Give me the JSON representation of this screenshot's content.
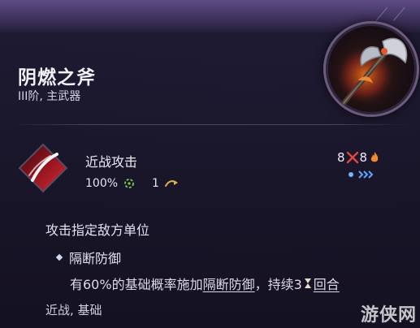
{
  "item": {
    "name": "阴燃之斧",
    "subtitle": "III阶, 主武器"
  },
  "skill": {
    "name": "近战攻击",
    "accuracy": "100%",
    "range": "1",
    "cost_action": "8",
    "cost_fire": "8",
    "description": "攻击指定敌方单位",
    "effect_name": "隔断防御",
    "effect_text": {
      "pre": "有60%的基础概率施加",
      "status_link": "隔断防御",
      "mid": "，持续3",
      "turn_link": "回合"
    },
    "tags": "近战, 基础"
  },
  "watermark": "游侠网",
  "icons": {
    "weapon": "axe-icon",
    "skill": "slash-icon",
    "accuracy": "crosshair-icon",
    "range": "arrow-icon",
    "action_cost": "crossed-blades-icon",
    "fire_cost": "flame-icon",
    "energy": "energy-pips-icon",
    "turns": "hourglass-icon"
  },
  "colors": {
    "accent_red": "#c0202a",
    "accuracy_green": "#7fc94a",
    "range_gold": "#e0b24c",
    "energy_blue": "#5aa8ff"
  }
}
